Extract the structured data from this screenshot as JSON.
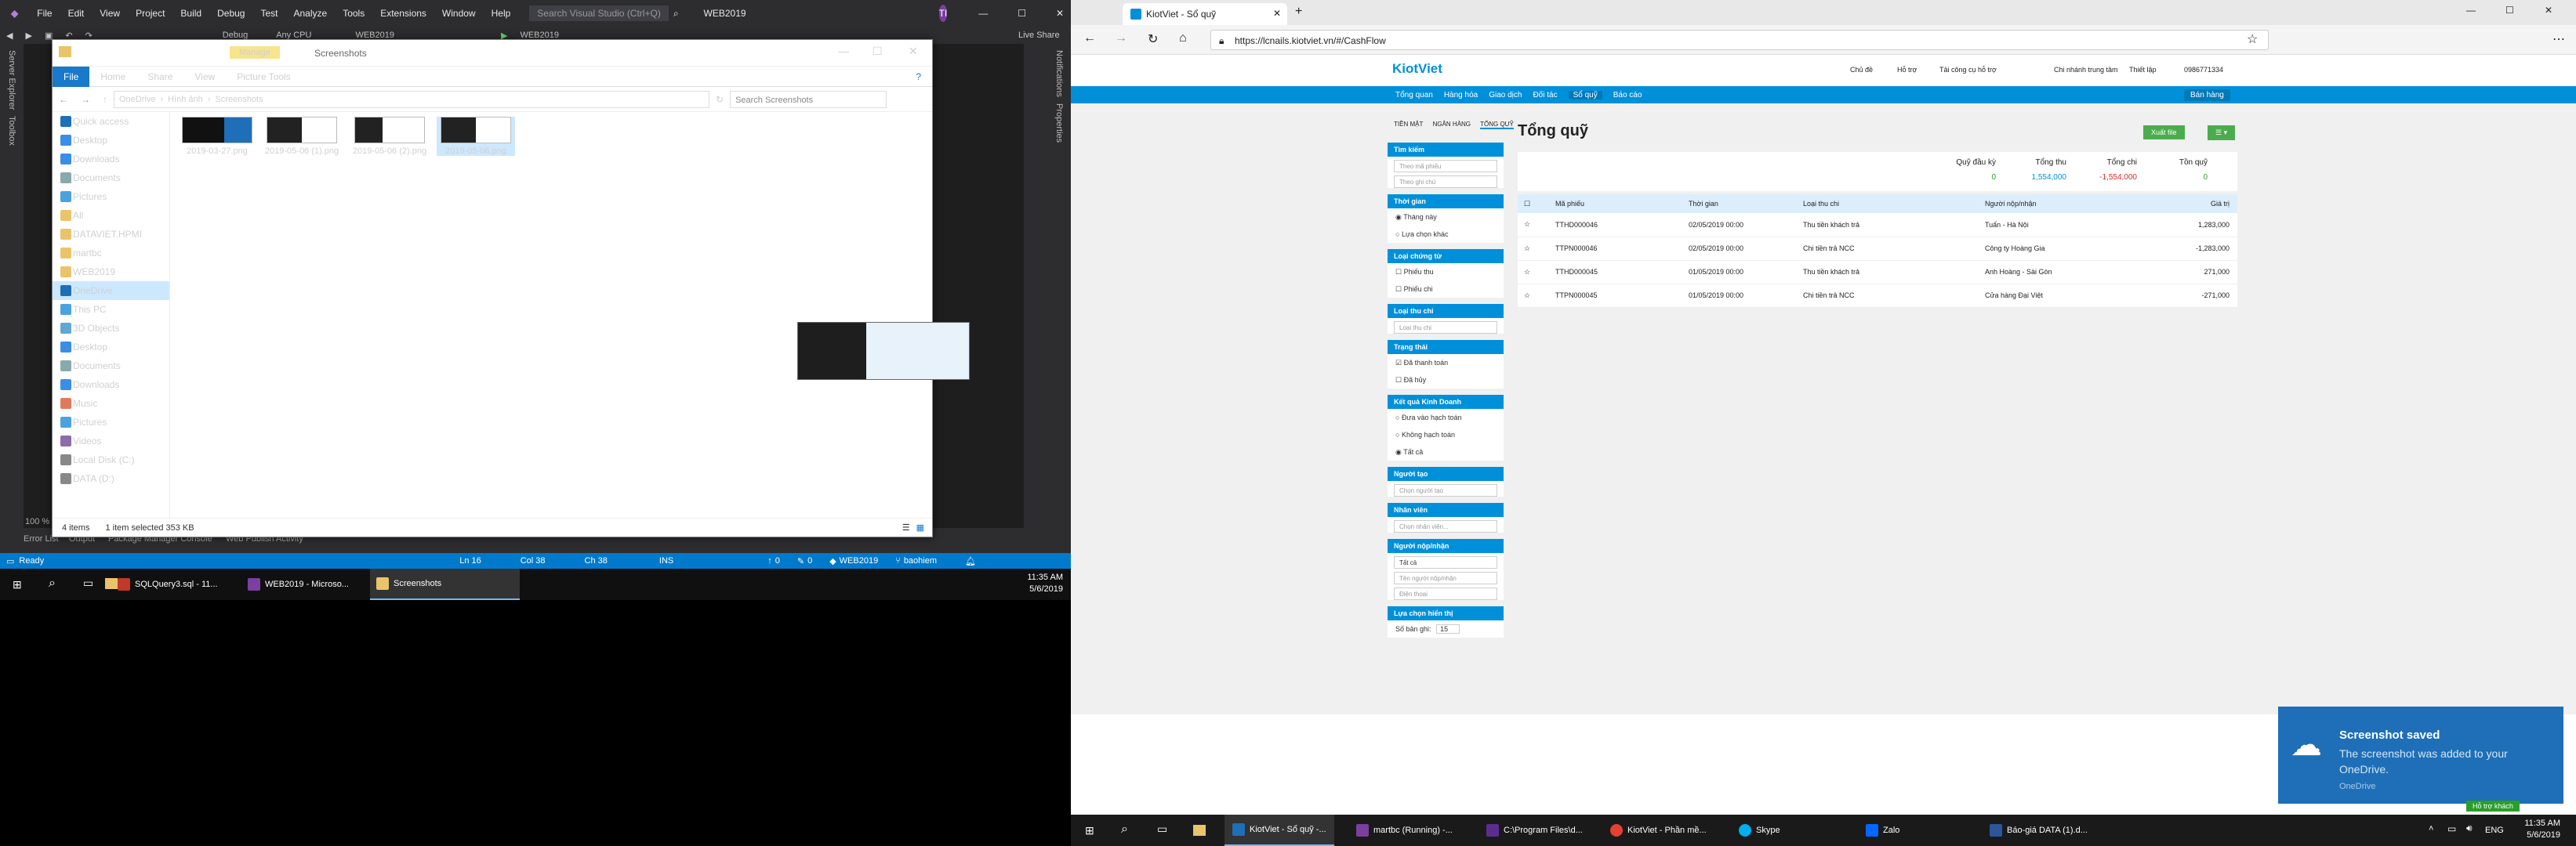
{
  "left_monitor": {
    "vs": {
      "menu": [
        "File",
        "Edit",
        "View",
        "Project",
        "Build",
        "Debug",
        "Test",
        "Analyze",
        "Tools",
        "Extensions",
        "Window",
        "Help"
      ],
      "search_placeholder": "Search Visual Studio (Ctrl+Q)",
      "solution_name": "WEB2019",
      "user_initials": "TI",
      "live_share": "Live Share",
      "toolbar": {
        "config": "Debug",
        "platform": "Any CPU",
        "project": "WEB2019",
        "run_target": "WEB2019"
      },
      "left_sidebar": [
        "Server Explorer",
        "Toolbox"
      ],
      "right_sidebar": [
        "Notifications",
        "Properties"
      ],
      "zoom": "100 %",
      "bottom_tabs": [
        "Error List",
        "Output",
        "Package Manager Console",
        "Web Publish Activity"
      ],
      "statusbar": {
        "ready": "Ready",
        "ln": "Ln 16",
        "col": "Col 38",
        "ch": "Ch 38",
        "ins": "INS",
        "up": "0",
        "pencil": "0",
        "project": "WEB2019",
        "branch": "baohiem"
      }
    },
    "explorer": {
      "title": "Screenshots",
      "context_tab": "Manage",
      "ribbon_tabs": [
        "File",
        "Home",
        "Share",
        "View",
        "Picture Tools"
      ],
      "path": [
        "OneDrive",
        "Hình ảnh",
        "Screenshots"
      ],
      "search_placeholder": "Search Screenshots",
      "nav": [
        {
          "label": "Quick access",
          "icon": "star-icon"
        },
        {
          "label": "Desktop",
          "icon": "desktop-icon"
        },
        {
          "label": "Downloads",
          "icon": "download-icon"
        },
        {
          "label": "Documents",
          "icon": "document-icon"
        },
        {
          "label": "Pictures",
          "icon": "picture-icon"
        },
        {
          "label": "All",
          "icon": "folder-icon"
        },
        {
          "label": "DATAVIET.HPMI",
          "icon": "folder-icon"
        },
        {
          "label": "martbc",
          "icon": "folder-icon"
        },
        {
          "label": "WEB2019",
          "icon": "folder-icon"
        },
        {
          "label": "OneDrive",
          "icon": "cloud-icon"
        },
        {
          "label": "This PC",
          "icon": "pc-icon"
        },
        {
          "label": "3D Objects",
          "icon": "cube-icon"
        },
        {
          "label": "Desktop",
          "icon": "desktop-icon"
        },
        {
          "label": "Documents",
          "icon": "document-icon"
        },
        {
          "label": "Downloads",
          "icon": "download-icon"
        },
        {
          "label": "Music",
          "icon": "music-icon"
        },
        {
          "label": "Pictures",
          "icon": "picture-icon"
        },
        {
          "label": "Videos",
          "icon": "video-icon"
        },
        {
          "label": "Local Disk (C:)",
          "icon": "disk-icon"
        },
        {
          "label": "DATA (D:)",
          "icon": "disk-icon"
        }
      ],
      "files": [
        "2019-03-27.png",
        "2019-05-06 (1).png",
        "2019-05-06 (2).png",
        "2019-05-06.png"
      ],
      "status": {
        "items": "4 items",
        "selected": "1 item selected  353 KB"
      }
    },
    "taskbar": {
      "items": [
        "SQLQuery3.sql - 11...",
        "WEB2019 - Microso...",
        "Screenshots"
      ],
      "time": "11:35 AM",
      "date": "5/6/2019"
    }
  },
  "right_monitor": {
    "chrome": {
      "tab_title": "KiotViet - Sổ quỹ",
      "url": "https://lcnails.kiotviet.vn/#/CashFlow"
    },
    "kiot": {
      "logo": "KiotViet",
      "top_links": [
        "Chủ đề",
        "Hỗ trợ",
        "Tải công cụ hỗ trợ",
        "Chi nhánh trung tâm",
        "Thiết lập",
        "0986771334"
      ],
      "nav": [
        "Tổng quan",
        "Hàng hóa",
        "Giao dịch",
        "Đối tác",
        "Sổ quỹ",
        "Báo cáo"
      ],
      "sell_button": "Bán hàng",
      "view_tabs": [
        "TIỀN MẶT",
        "NGÂN HÀNG",
        "TỔNG QUỸ"
      ],
      "title": "Tổng quỹ",
      "add_button": "Xuất file",
      "summary_labels": [
        "Quỹ đầu kỳ",
        "Tổng thu",
        "Tổng chi",
        "Tồn quỹ"
      ],
      "summary_values": [
        "0",
        "1,554,000",
        "-1,554,000",
        "0"
      ],
      "sidebar": {
        "search": {
          "header": "Tìm kiếm",
          "ph1": "Theo mã phiếu",
          "ph2": "Theo ghi chú"
        },
        "time": {
          "header": "Thời gian",
          "opt1": "Tháng này",
          "opt2": "Lựa chọn khác"
        },
        "voucher": {
          "header": "Loại chứng từ",
          "opt1": "Phiếu thu",
          "opt2": "Phiếu chi"
        },
        "type": {
          "header": "Loại thu chi",
          "ph": "Loại thu chi"
        },
        "state": {
          "header": "Trạng thái",
          "opt1": "Đã thanh toán",
          "opt2": "Đã hủy"
        },
        "business": {
          "header": "Kết quả Kinh Doanh",
          "opt1": "Đưa vào hạch toán",
          "opt2": "Không hạch toán",
          "opt3": "Tất cả"
        },
        "creator": {
          "header": "Người tạo",
          "ph": "Chọn người tạo"
        },
        "staff": {
          "header": "Nhân viên",
          "ph": "Chọn nhân viên..."
        },
        "payer": {
          "header": "Người nộp/nhận",
          "sel": "Tất cả",
          "ph1": "Tên người nộp/nhận",
          "ph2": "Điện thoại"
        },
        "display": {
          "header": "Lựa chọn hiển thị",
          "label": "Số bản ghi:",
          "value": "15"
        }
      },
      "table": {
        "headers": [
          "Mã phiếu",
          "Thời gian",
          "Loại thu chi",
          "Người nộp/nhận",
          "Giá trị"
        ],
        "rows": [
          [
            "TTHD000046",
            "02/05/2019 00:00",
            "Thu tiền khách trả",
            "Tuấn - Hà Nội",
            "1,283,000"
          ],
          [
            "TTPN000046",
            "02/05/2019 00:00",
            "Chi tiền trả NCC",
            "Công ty Hoàng Gia",
            "-1,283,000"
          ],
          [
            "TTHD000045",
            "01/05/2019 00:00",
            "Thu tiền khách trả",
            "Anh Hoàng - Sài Gòn",
            "271,000"
          ],
          [
            "TTPN000045",
            "01/05/2019 00:00",
            "Chi tiền trả NCC",
            "Cửa hàng Đại Việt",
            "-271,000"
          ]
        ]
      },
      "chat_badge": "Hỗ trợ khách"
    },
    "toast": {
      "title": "Screenshot saved",
      "body": "The screenshot was added to your OneDrive.",
      "source": "OneDrive"
    },
    "taskbar": {
      "items": [
        "KiotViet - Sổ quỹ -...",
        "martbc (Running) -...",
        "C:\\Program Files\\d...",
        "KiotViet - Phần mề...",
        "Skype",
        "Zalo",
        "Báo-giá DATA (1).d..."
      ],
      "lang": "ENG",
      "time": "11:35 AM",
      "date": "5/6/2019"
    }
  }
}
